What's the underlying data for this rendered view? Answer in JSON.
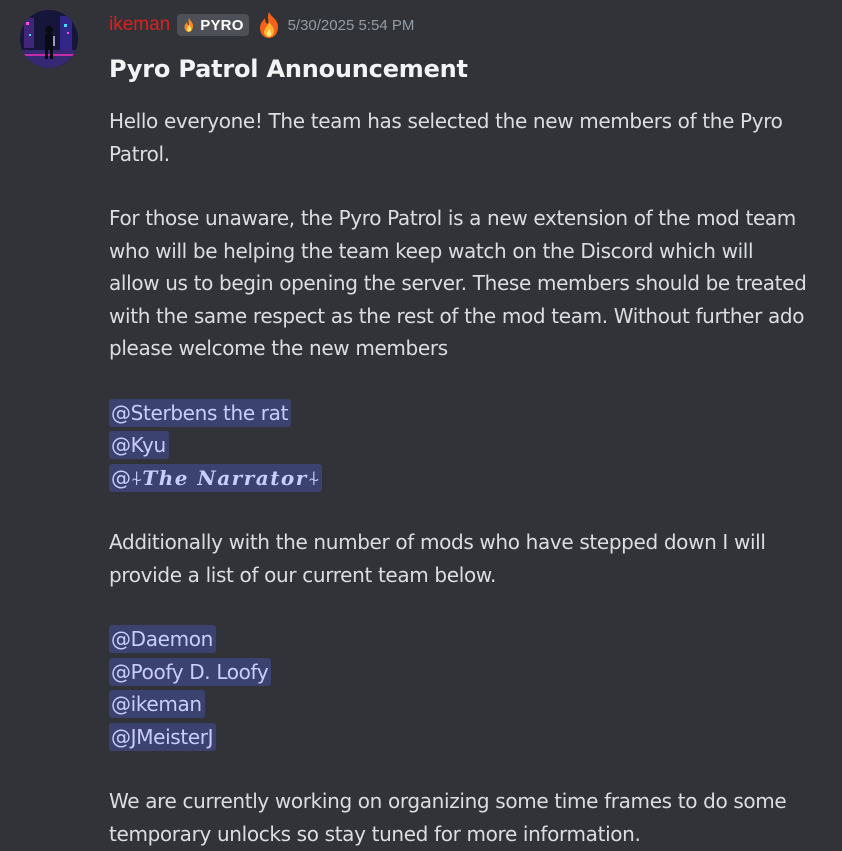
{
  "author": {
    "username": "ikeman",
    "tag": "PYRO",
    "timestamp": "5/30/2025 5:54 PM"
  },
  "message": {
    "title": "Pyro Patrol Announcement",
    "para1": "Hello everyone! The team has selected the new members of the Pyro Patrol.",
    "para2": "For those unaware, the Pyro Patrol is a new extension of the mod team who will be helping the team keep watch on the Discord which will allow us to begin opening the server. These members should be treated with the same respect as the rest of the mod team. Without further ado please welcome the new members",
    "new_members": [
      {
        "prefix": "@",
        "name": "Sterbens the rat"
      },
      {
        "prefix": "@",
        "name": "Kyu"
      },
      {
        "prefix": "@",
        "mark_left": "⍭",
        "name": "The Narrator",
        "mark_right": "⍭"
      }
    ],
    "para3": "Additionally with the number of mods who have stepped down I will provide a list of our current team below.",
    "current_team": [
      {
        "prefix": "@",
        "name": "Daemon"
      },
      {
        "prefix": "@",
        "name": "Poofy D. Loofy"
      },
      {
        "prefix": "@",
        "name": "ikeman"
      },
      {
        "prefix": "@",
        "name": "JMeisterJ"
      }
    ],
    "para4": "We are currently working on organizing some time frames to do some temporary unlocks so stay tuned for more information."
  },
  "icons": {
    "tag_icon": "flame-icon",
    "role_icon": "fire-emoji-icon",
    "avatar": "cyberpunk-figure-avatar"
  },
  "colors": {
    "background": "#313338",
    "username": "#e01e1e",
    "mention_bg": "#3c4270",
    "mention_text": "#c9cdfb",
    "timestamp": "#949ba4"
  }
}
